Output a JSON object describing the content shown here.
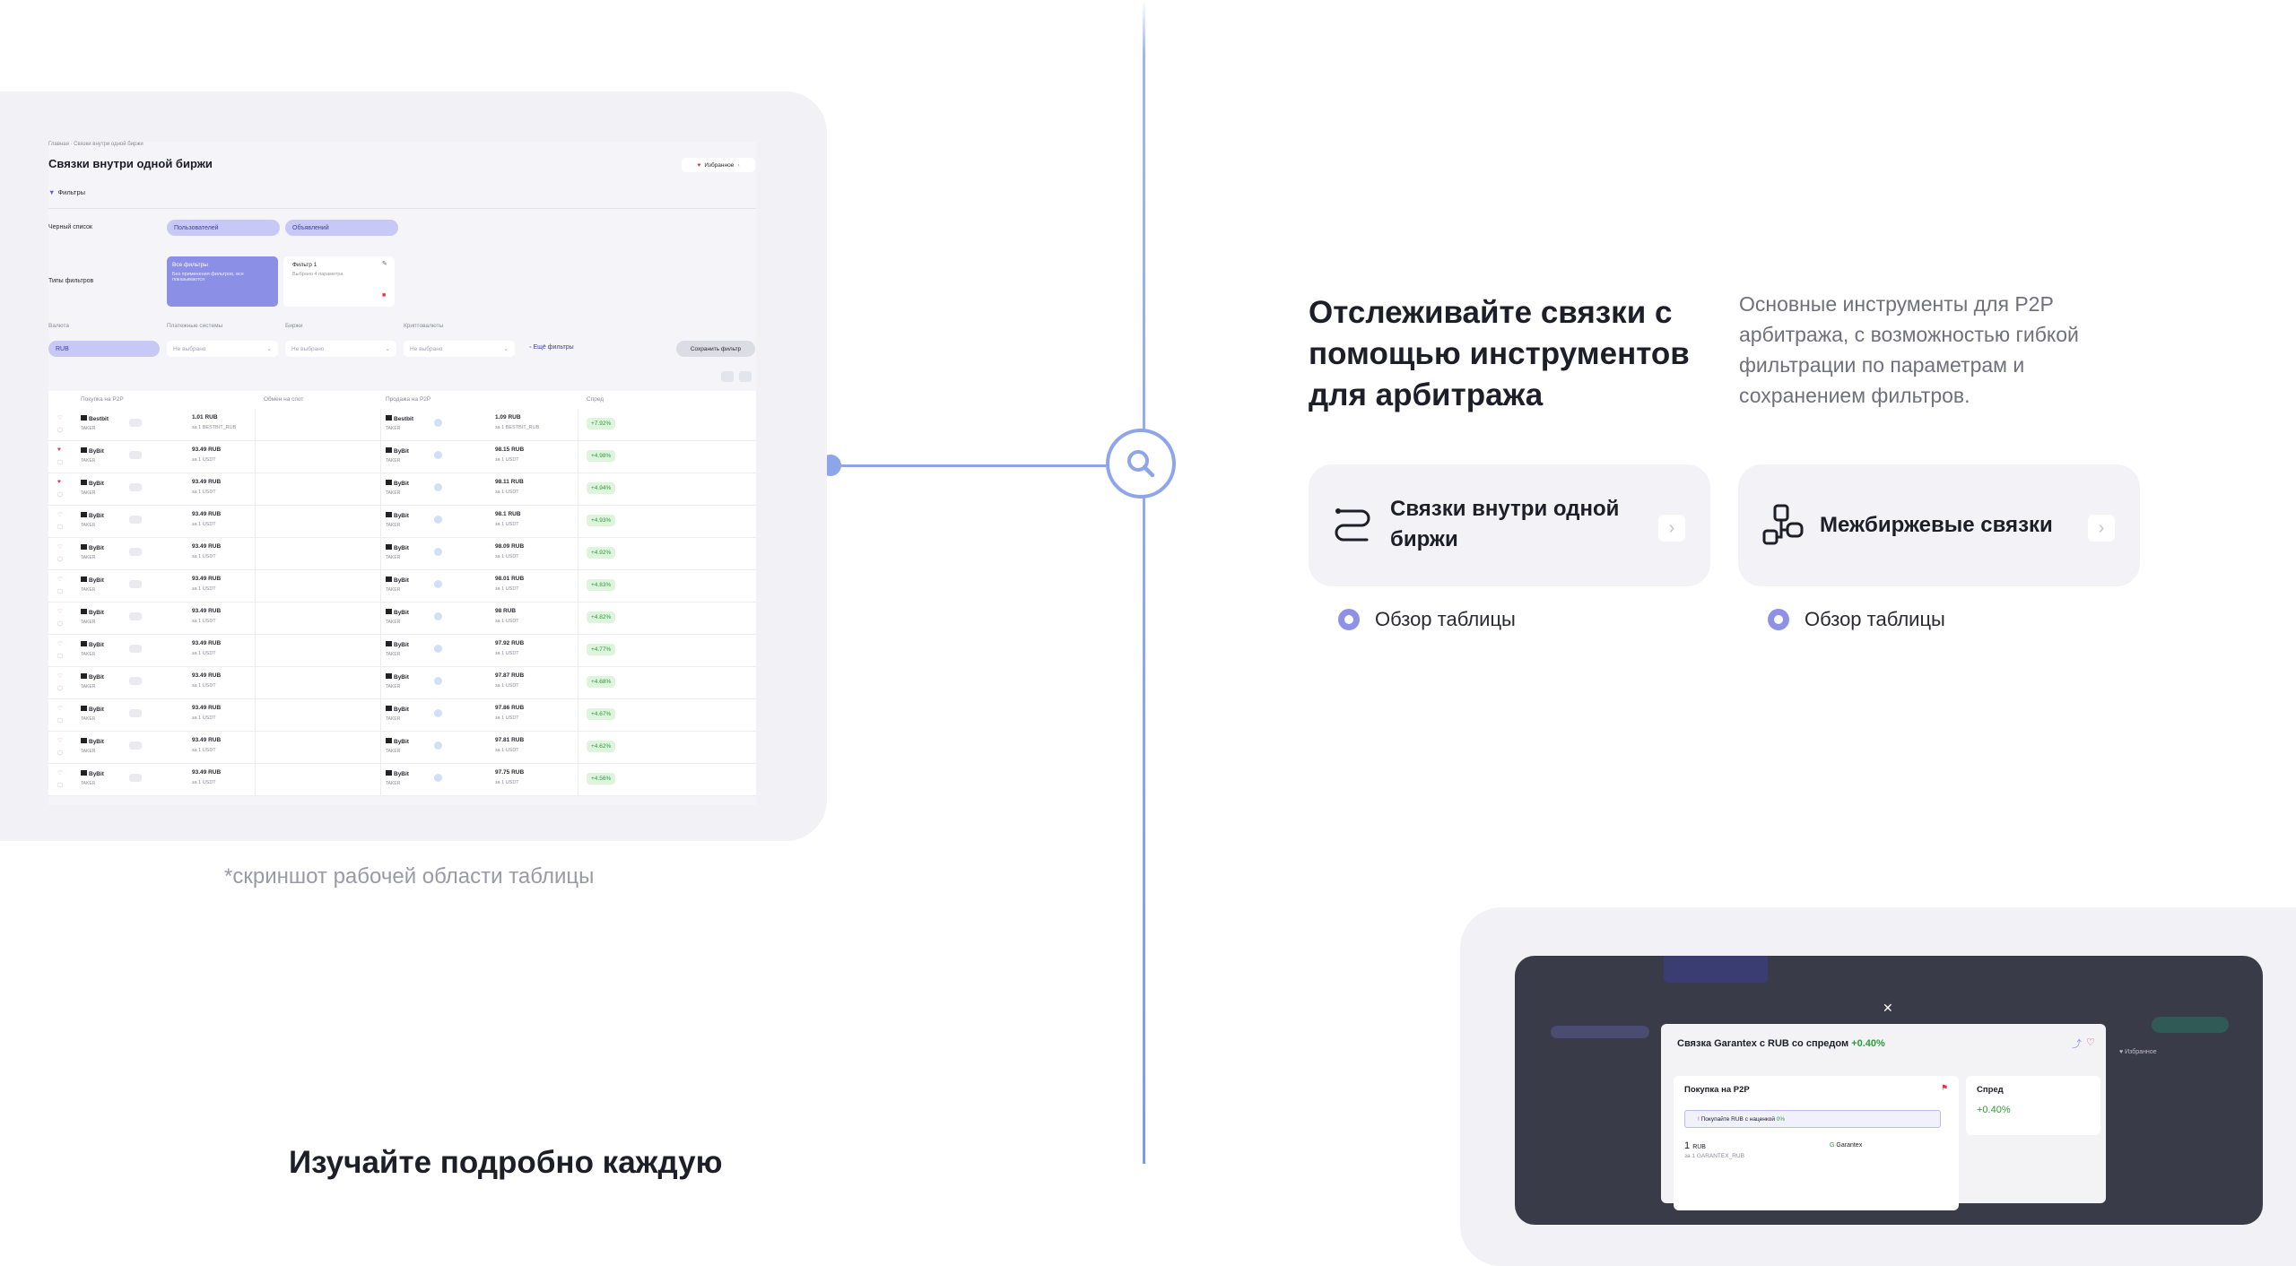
{
  "screenshot": {
    "breadcrumb": "Главная · Связки внутри одной биржи",
    "title": "Связки внутри одной биржи",
    "favorites_label": "Избранное",
    "filters_label": "Фильтры",
    "blacklist_label": "Черный список",
    "blacklist_users": "Пользователей",
    "blacklist_ads": "Объявлений",
    "filter_types_label": "Типы фильтров",
    "filter_all_title": "Все фильтры",
    "filter_all_desc": "Без применения фильтров, все показываются",
    "filter1_title": "Фильтр 1",
    "filter1_desc": "Выбрано 4 параметра",
    "currency_label": "Валюта",
    "currency_value": "RUB",
    "payment_label": "Платежные системы",
    "exchanges_label": "Биржи",
    "crypto_label": "Криптовалюты",
    "not_selected": "Не выбрано",
    "more_filters": "Ещё фильтры",
    "save_filter": "Сохранить фильтр",
    "columns": [
      "Покупка на P2P",
      "Обмен на спот",
      "Продажа на P2P",
      "Спред"
    ],
    "rows": [
      {
        "buy_exchange": "Bestbit",
        "buy_price": "1.01 RUB",
        "buy_sub": "за 1 BESTBIT_RUB",
        "sell_exchange": "Bestbit",
        "sell_price": "1.09 RUB",
        "sell_sub": "за 1 BESTBIT_RUB",
        "spread": "+7.92%",
        "fav": false
      },
      {
        "buy_exchange": "ByBit",
        "buy_price": "93.49 RUB",
        "buy_sub": "за 1 USDT",
        "sell_exchange": "ByBit",
        "sell_price": "98.15 RUB",
        "sell_sub": "за 1 USDT",
        "spread": "+4.98%",
        "fav": true
      },
      {
        "buy_exchange": "ByBit",
        "buy_price": "93.49 RUB",
        "buy_sub": "за 1 USDT",
        "sell_exchange": "ByBit",
        "sell_price": "98.11 RUB",
        "sell_sub": "за 1 USDT",
        "spread": "+4.94%",
        "fav": true
      },
      {
        "buy_exchange": "ByBit",
        "buy_price": "93.49 RUB",
        "buy_sub": "за 1 USDT",
        "sell_exchange": "ByBit",
        "sell_price": "98.1 RUB",
        "sell_sub": "за 1 USDT",
        "spread": "+4.93%",
        "fav": false
      },
      {
        "buy_exchange": "ByBit",
        "buy_price": "93.49 RUB",
        "buy_sub": "за 1 USDT",
        "sell_exchange": "ByBit",
        "sell_price": "98.09 RUB",
        "sell_sub": "за 1 USDT",
        "spread": "+4.92%",
        "fav": false
      },
      {
        "buy_exchange": "ByBit",
        "buy_price": "93.49 RUB",
        "buy_sub": "за 1 USDT",
        "sell_exchange": "ByBit",
        "sell_price": "98.01 RUB",
        "sell_sub": "за 1 USDT",
        "spread": "+4.83%",
        "fav": false
      },
      {
        "buy_exchange": "ByBit",
        "buy_price": "93.49 RUB",
        "buy_sub": "за 1 USDT",
        "sell_exchange": "ByBit",
        "sell_price": "98 RUB",
        "sell_sub": "за 1 USDT",
        "spread": "+4.82%",
        "fav": false
      },
      {
        "buy_exchange": "ByBit",
        "buy_price": "93.49 RUB",
        "buy_sub": "за 1 USDT",
        "sell_exchange": "ByBit",
        "sell_price": "97.92 RUB",
        "sell_sub": "за 1 USDT",
        "spread": "+4.77%",
        "fav": false
      },
      {
        "buy_exchange": "ByBit",
        "buy_price": "93.49 RUB",
        "buy_sub": "за 1 USDT",
        "sell_exchange": "ByBit",
        "sell_price": "97.87 RUB",
        "sell_sub": "за 1 USDT",
        "spread": "+4.68%",
        "fav": false
      },
      {
        "buy_exchange": "ByBit",
        "buy_price": "93.49 RUB",
        "buy_sub": "за 1 USDT",
        "sell_exchange": "ByBit",
        "sell_price": "97.86 RUB",
        "sell_sub": "за 1 USDT",
        "spread": "+4.67%",
        "fav": false
      },
      {
        "buy_exchange": "ByBit",
        "buy_price": "93.49 RUB",
        "buy_sub": "за 1 USDT",
        "sell_exchange": "ByBit",
        "sell_price": "97.81 RUB",
        "sell_sub": "за 1 USDT",
        "spread": "+4.62%",
        "fav": false
      },
      {
        "buy_exchange": "ByBit",
        "buy_price": "93.49 RUB",
        "buy_sub": "за 1 USDT",
        "sell_exchange": "ByBit",
        "sell_price": "97.75 RUB",
        "sell_sub": "за 1 USDT",
        "spread": "+4.56%",
        "fav": false
      }
    ]
  },
  "caption": "*скриншот рабочей области таблицы",
  "headline": "Отслеживайте связки с помощью инструментов для арбитража",
  "description": "Основные инструменты для P2P арбитража, с возможностью гибкой фильтрации по параметрам и сохранением фильтров.",
  "tools": [
    {
      "title": "Связки внутри одной биржи",
      "icon": "route-icon",
      "overview": "Обзор таблицы"
    },
    {
      "title": "Межбиржевые связки",
      "icon": "exchange-network-icon",
      "overview": "Обзор таблицы"
    }
  ],
  "modal": {
    "title_prefix": "Связка Garantex с RUB со спредом",
    "title_spread": "+0.40%",
    "buy_label": "Покупка на P2P",
    "buy_note": "Покупайте RUB с наценкой",
    "buy_note_value": "0%",
    "price": "1",
    "price_unit": "RUB",
    "price_sub": "за 1 GARANTEX_RUB",
    "exchange": "Garantex",
    "spread_label": "Спред",
    "spread_value": "+0.40%",
    "favorites_label": "Избранное"
  },
  "bottom_heading": "Изучайте подробно каждую",
  "colors": {
    "accent": "#8ea5ea",
    "pill": "#c7c8f5",
    "positive": "#2f9a3c",
    "favorite": "#e0334b"
  }
}
